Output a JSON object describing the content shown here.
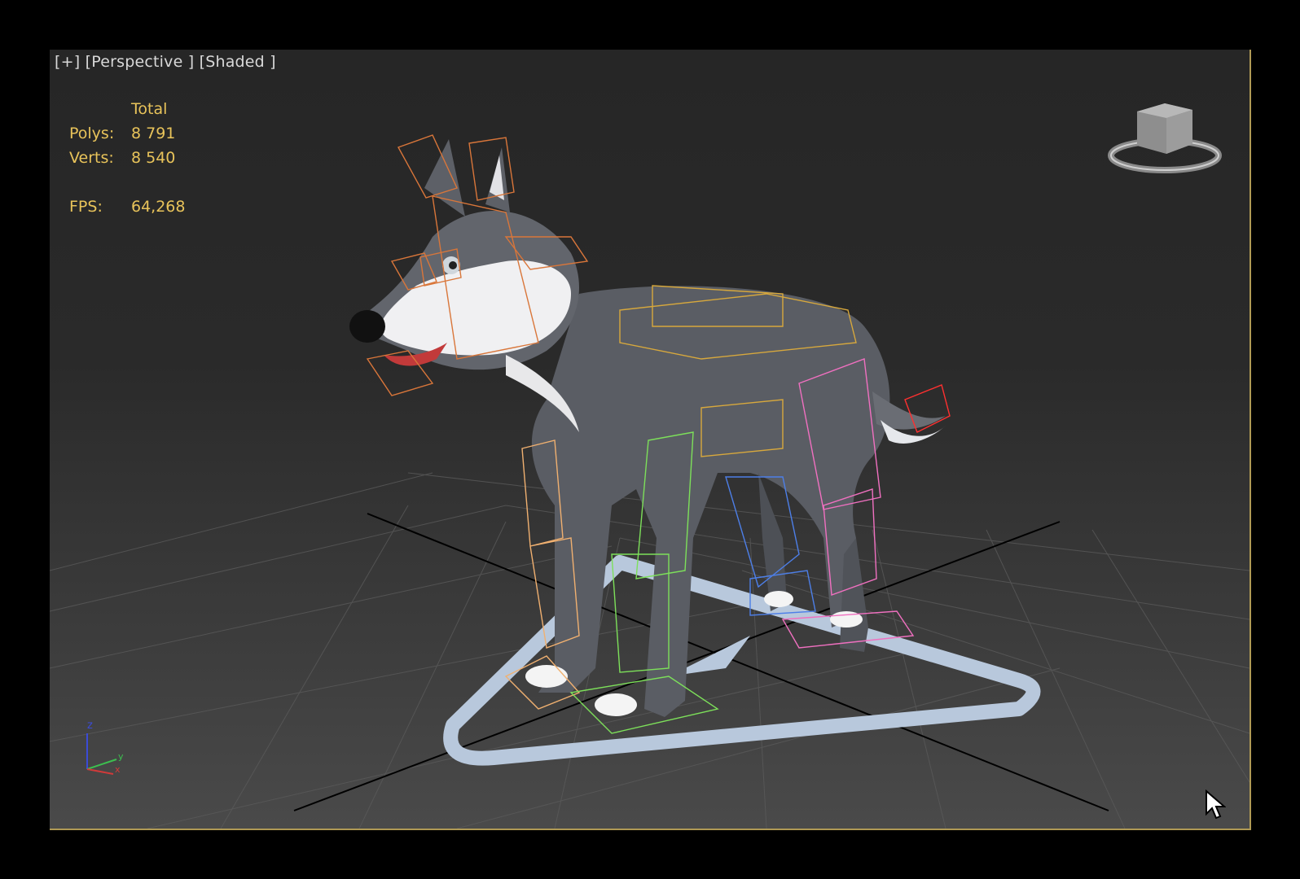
{
  "viewport": {
    "labels": {
      "plus": "[+]",
      "view": "[Perspective ]",
      "shading": "[Shaded ]"
    },
    "stats": {
      "header": "Total",
      "rows": [
        {
          "key": "Polys:",
          "value": "8 791"
        },
        {
          "key": "Verts:",
          "value": "8 540"
        }
      ],
      "fps_key": "FPS:",
      "fps_value": "64,268"
    },
    "viewcube": {
      "icon": "viewcube-icon"
    },
    "axis_tripod": {
      "x": "x",
      "y": "y",
      "z": "z"
    },
    "colors": {
      "stats_text": "#e8c35a",
      "frame_border": "#b09a55",
      "bone_head": "#d9763a",
      "bone_spine": "#d7a83d",
      "bone_front_left": "#f0b070",
      "bone_front_right": "#7de05a",
      "bone_back_right": "#4d7fe8",
      "bone_back_left": "#f070c0",
      "bone_tail": "#ff3030",
      "control_shape": "#b8c8dc"
    }
  }
}
